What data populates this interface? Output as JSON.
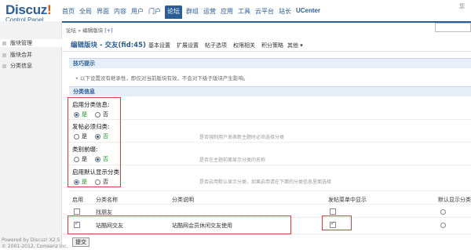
{
  "logo": {
    "title_main": "Discuz",
    "title_bang": "!",
    "subtitle": "Control Panel"
  },
  "topnav": [
    {
      "label": "首页"
    },
    {
      "label": "全局"
    },
    {
      "label": "界面"
    },
    {
      "label": "内容"
    },
    {
      "label": "用户"
    },
    {
      "label": "门户"
    },
    {
      "label": "论坛",
      "active": true
    },
    {
      "label": "群组"
    },
    {
      "label": "运营"
    },
    {
      "label": "应用"
    },
    {
      "label": "工具"
    },
    {
      "label": "云平台"
    },
    {
      "label": "站长"
    },
    {
      "label": "UCenter",
      "brand": true
    }
  ],
  "user_area": "您",
  "sidebar": {
    "items": [
      {
        "label": "版块管理",
        "active": true
      },
      {
        "label": "版块合并"
      },
      {
        "label": "分类信息"
      }
    ],
    "footer_line1": "Powered by Discuz! X2.5",
    "footer_line2": "© 2001-2012, Comsenz Inc."
  },
  "breadcrumb": {
    "path": "论坛 » 编辑版块",
    "plus": "[+]"
  },
  "tabs": {
    "title": "编辑版块 - 交友(fid:45)",
    "items": [
      "基本设置",
      "扩展设置",
      "帖子选项",
      "权限相关",
      "积分策略",
      "其他 ▾"
    ]
  },
  "tips": {
    "title": "技巧提示",
    "text": "• 以下设置没有继承性，即仅对当前版块有效，不会对下级子版块产生影响。"
  },
  "section": {
    "title": "分类信息"
  },
  "settings": [
    {
      "label": "启用分类信息:",
      "yes": "是",
      "no": "否",
      "selected": "yes",
      "hint": ""
    },
    {
      "label": "发帖必须归类:",
      "yes": "是",
      "no": "否",
      "selected": "no",
      "hint": "是否强制用户发表新主题时必须选择分类"
    },
    {
      "label": "类别前缀:",
      "yes": "是",
      "no": "否",
      "selected": "no",
      "hint": "是否在主题前面显示分类的名称"
    },
    {
      "label": "启用默认显示分类:",
      "yes": "是",
      "no": "否",
      "selected": "yes",
      "hint": "是否启用默认显示分类，如果启用请在下面的分类信息里面选择"
    }
  ],
  "table": {
    "headers": {
      "enable": "启用",
      "name": "分类名称",
      "desc": "分类说明",
      "show": "发帖菜单中显示",
      "default": "默认显示分类"
    },
    "rows": [
      {
        "name": "找朋友",
        "desc": "",
        "enabled": false,
        "show": false
      },
      {
        "name": "站酷网交友",
        "desc": "站酷网会员休闲交友使用",
        "enabled": true,
        "show": true
      }
    ]
  },
  "submit_label": "提交",
  "colors": {
    "accent": "#2b5e95",
    "highlight": "#e23b3b",
    "green": "#149a14"
  }
}
